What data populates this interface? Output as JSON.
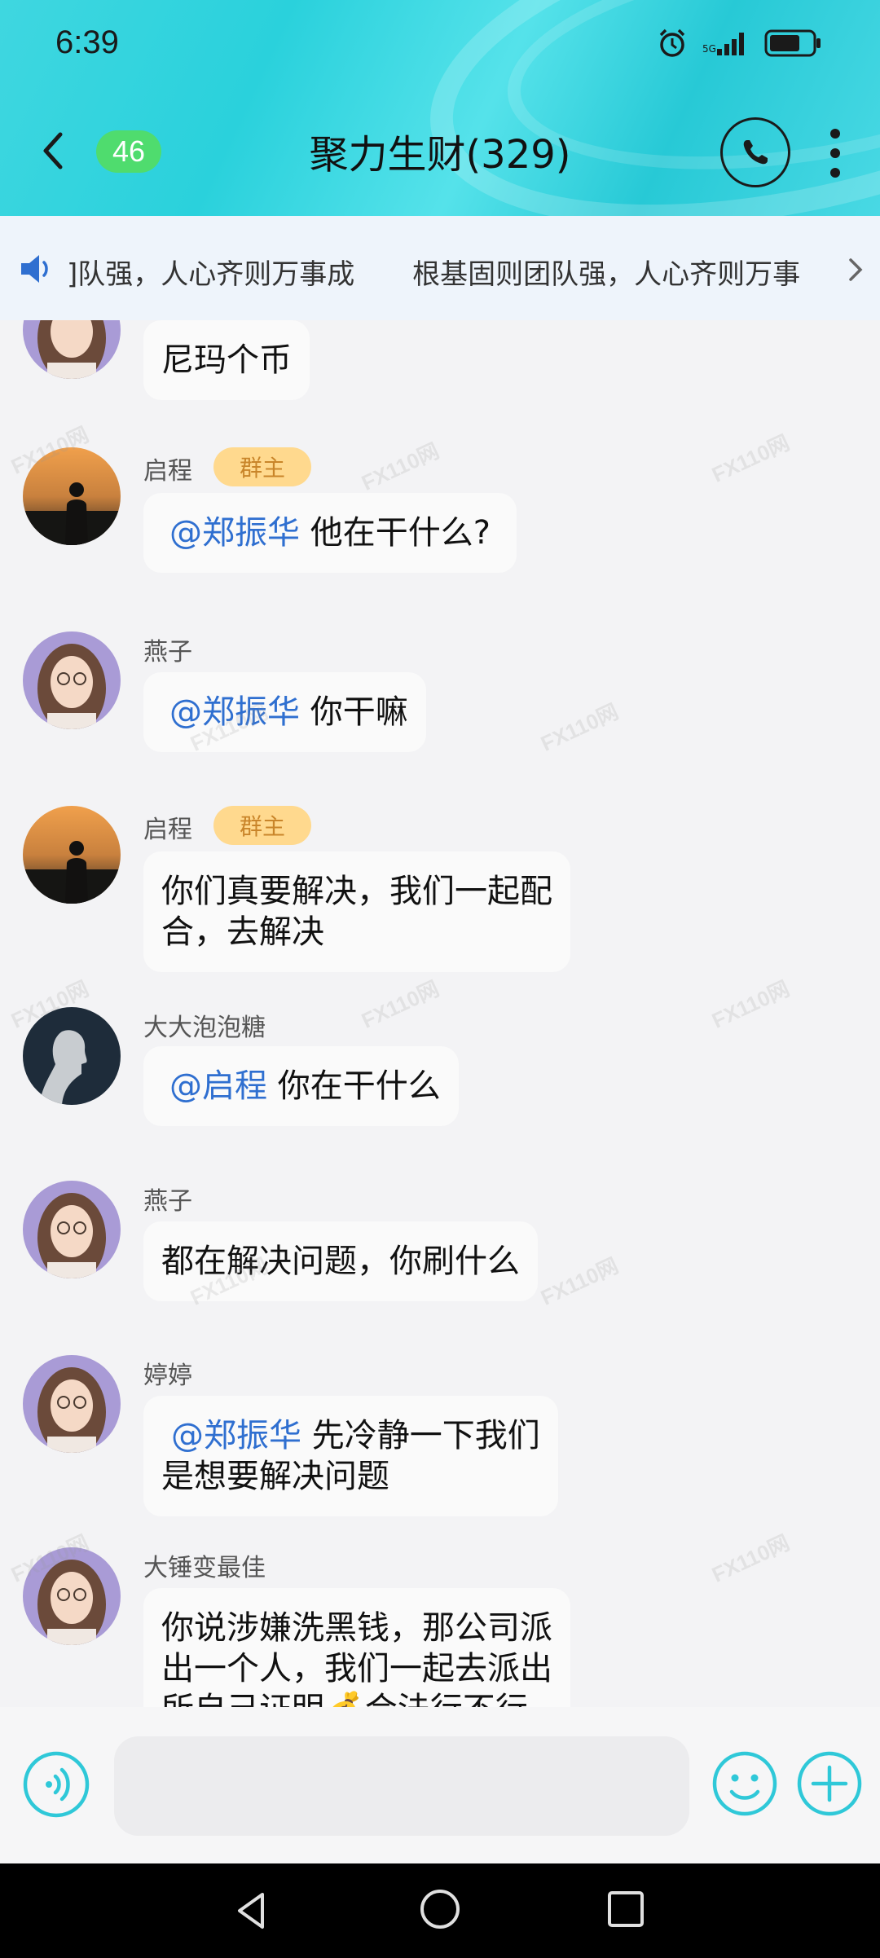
{
  "status_bar": {
    "time": "6:39"
  },
  "header": {
    "unread_count": "46",
    "title": "聚力生财(329)"
  },
  "notice": {
    "text_1": "]队强，人心齐则万事成",
    "text_2": "根基固则团队强，人心齐则万事"
  },
  "messages": [
    {
      "sender": "",
      "text": "尼玛个币"
    },
    {
      "sender": "启程",
      "badge": "群主",
      "mention": "@郑振华",
      "text": " 他在干什么?"
    },
    {
      "sender": "燕子",
      "mention": "@郑振华",
      "text": " 你干嘛"
    },
    {
      "sender": "启程",
      "badge": "群主",
      "text_line1": "你们真要解决，我们一起配",
      "text_line2": "合，去解决"
    },
    {
      "sender": "大大泡泡糖",
      "mention": "@启程",
      "text": " 你在干什么"
    },
    {
      "sender": "燕子",
      "text": "都在解决问题，你刷什么"
    },
    {
      "sender": "婷婷",
      "mention": "@郑振华",
      "text_line1": " 先冷静一下我们",
      "text_line2": "是想要解决问题"
    },
    {
      "sender": "大锤变最佳",
      "text_line1": "你说涉嫌洗黑钱，那公司派",
      "text_line2": "出一个人，我们一起去派出",
      "text_line3": "所自己证明💰合法行不行"
    }
  ],
  "input": {
    "value": ""
  },
  "watermark": "FX110网",
  "colors": {
    "header_accent": "#2ad1dc",
    "mention": "#2f6fd0",
    "badge_bg": "#ffd98e",
    "badge_text": "#c9852a",
    "unread_badge": "#4fdc6e",
    "input_icons": "#2fc8d8"
  }
}
